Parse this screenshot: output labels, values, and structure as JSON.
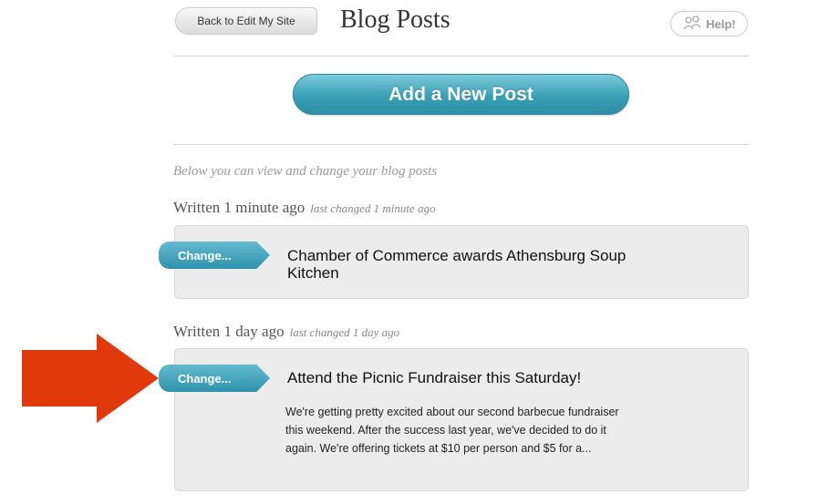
{
  "header": {
    "back_label": "Back to Edit My Site",
    "title": "Blog Posts",
    "help_label": "Help!"
  },
  "add_post_label": "Add a New Post",
  "intro_text": "Below you can view and change your blog posts",
  "posts": [
    {
      "written": "Written 1 minute ago",
      "changed": "last changed 1 minute ago",
      "change_label": "Change...",
      "title": "Chamber of Commerce awards Athensburg Soup Kitchen",
      "excerpt": ""
    },
    {
      "written": "Written 1 day ago",
      "changed": "last changed 1 day ago",
      "change_label": "Change...",
      "title": "Attend the Picnic Fundraiser this Saturday!",
      "excerpt": "We're getting pretty excited about our second barbecue fundraiser this weekend. After the success last year, we've decided to do it again. We're offering tickets at $10 per person and $5 for a..."
    }
  ],
  "colors": {
    "accent": "#3a9fb6",
    "annotation_arrow": "#e03a0c"
  },
  "icons": {
    "help": "people-help-icon",
    "annotation": "arrow-right-icon"
  }
}
